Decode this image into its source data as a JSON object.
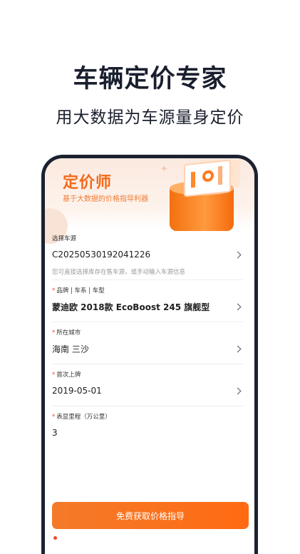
{
  "hero": {
    "title": "车辆定价专家",
    "subtitle": "用大数据为车源量身定价"
  },
  "app": {
    "title": "定价师",
    "tagline": "基于大数据的价格指导利器"
  },
  "form": {
    "source": {
      "label": "选择车源",
      "value": "C20250530192041226",
      "hint": "您可直接选择库存在售车源，或手动输入车源信息"
    },
    "model": {
      "required": "*",
      "label": "品牌 | 车系 | 车型",
      "value": "蒙迪欧 2018款 EcoBoost 245 旗舰型"
    },
    "city": {
      "required": "*",
      "label": "所在城市",
      "value": "海南 三沙"
    },
    "first_reg": {
      "required": "*",
      "label": "首次上牌",
      "value": "2019-05-01"
    },
    "mileage": {
      "required": "*",
      "label": "表显里程（万公里）",
      "value": "3"
    },
    "submit_label": "免费获取价格指导"
  },
  "colors": {
    "accent": "#f26a1b",
    "required": "#f0492b",
    "frame": "#1c2230"
  },
  "icons": [
    "chevron-right-icon",
    "chart-illustration-icon"
  ]
}
